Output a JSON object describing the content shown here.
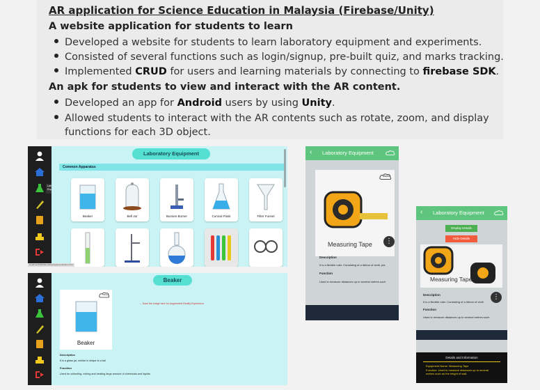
{
  "card": {
    "title": "AR application for Science Education in Malaysia (Firebase/Unity)",
    "sub1": "A website application for students to learn",
    "bullets1": [
      {
        "pre": "Developed a website for students to learn laboratory equipment and experiments.",
        "b1": "",
        "mid": "",
        "b2": "",
        "post": ""
      },
      {
        "pre": "Consisted of several functions such as login/signup, pre-built quiz, and marks tracking.",
        "b1": "",
        "mid": "",
        "b2": "",
        "post": ""
      },
      {
        "pre": "Implemented ",
        "b1": "CRUD",
        "mid": " for users and learning materials by connecting to ",
        "b2": "firebase SDK",
        "post": "."
      }
    ],
    "sub2": "An apk for students to view and interact with the AR content.",
    "bullets2": [
      {
        "pre": "Developed an app for ",
        "b1": "Android",
        "mid": " users by using ",
        "b2": "Unity",
        "post": "."
      },
      {
        "pre": "Allowed students to interact with the AR contents such as rotate, zoom, and display",
        "b1": "",
        "mid": "",
        "b2": "",
        "post": ""
      }
    ],
    "bullets2_cont": "functions for each 3D object."
  },
  "web1": {
    "title": "Laboratory Equipment",
    "section": "Common Apparatus",
    "tooltip": "Laboratory Equipment",
    "items": [
      "Beaker",
      "Bell Jar",
      "Bunsen Burner",
      "Conical Flask",
      "Filter Funnel"
    ],
    "status_url": "localhost:5000/laboratory/equipment/index.html"
  },
  "web2": {
    "title": "Beaker",
    "card_label": "Beaker",
    "marker": "Marker",
    "scan": "Scan the image here for Augmented Reality Experience",
    "desc_h": "Description",
    "desc": "It is a glass jar, similar in shape to a tall",
    "func_h": "Function",
    "func": "Used for collecting, mixing and heating large amount of chemicals and liquids"
  },
  "phone1": {
    "title": "Laboratory Equipment",
    "label": "Measuring Tape",
    "marker": "Marker",
    "desc_h": "Description",
    "desc": "It is a flexible ruler. Consisting of a ribbon of cloth, pla",
    "func_h": "Function",
    "func": "Used to measure distances up to several metres such"
  },
  "phone2": {
    "title": "Laboratory Equipment",
    "btn_display": "Display Details",
    "btn_hide": "Hide Details",
    "label": "Measuring Tape",
    "desc_h": "Description",
    "desc": "It is a flexible ruler. Consisting of a ribbon of cloth",
    "func_h": "Function",
    "func": "Used to measure distances up to several metres such",
    "details_title": "Details and Information",
    "details_name": "Equipment Name: Measuring Tape",
    "details_func": "Function: Used to measure distances up to several metres such as the height of wall."
  },
  "colors": {
    "teal_pill": "#55e0d3",
    "panel": "#c9f3f5",
    "sidebar": "#1e1e1e",
    "phone_bar": "#5ec57e",
    "button_green": "#4caf50",
    "button_red": "#f25c3c"
  }
}
